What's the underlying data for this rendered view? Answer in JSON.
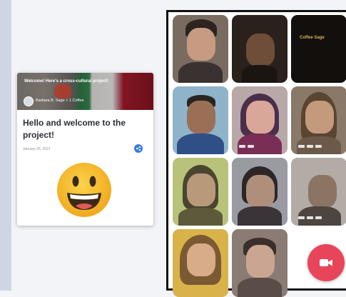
{
  "post": {
    "cover_title": "Welcome! Here's a cross-cultural project!",
    "author": "Barbara B. Sage + 1 Coffee",
    "title": "Hello and welcome to the project!",
    "date": "January 26, 2021",
    "share_icon": "share-icon",
    "emoji": "grinning-face-emoji"
  },
  "video_call": {
    "tiles": [
      {
        "kind": "participant"
      },
      {
        "kind": "participant"
      },
      {
        "kind": "name-card",
        "label": "Coffee Sage"
      },
      {
        "kind": "participant"
      },
      {
        "kind": "participant"
      },
      {
        "kind": "participant"
      },
      {
        "kind": "participant"
      },
      {
        "kind": "participant"
      },
      {
        "kind": "participant"
      },
      {
        "kind": "participant"
      },
      {
        "kind": "participant"
      }
    ],
    "record_icon": "video-camera-icon"
  },
  "colors": {
    "accent_blue": "#3a7be0",
    "record_red": "#e8455a",
    "emoji_yellow": "#f5b82e"
  }
}
